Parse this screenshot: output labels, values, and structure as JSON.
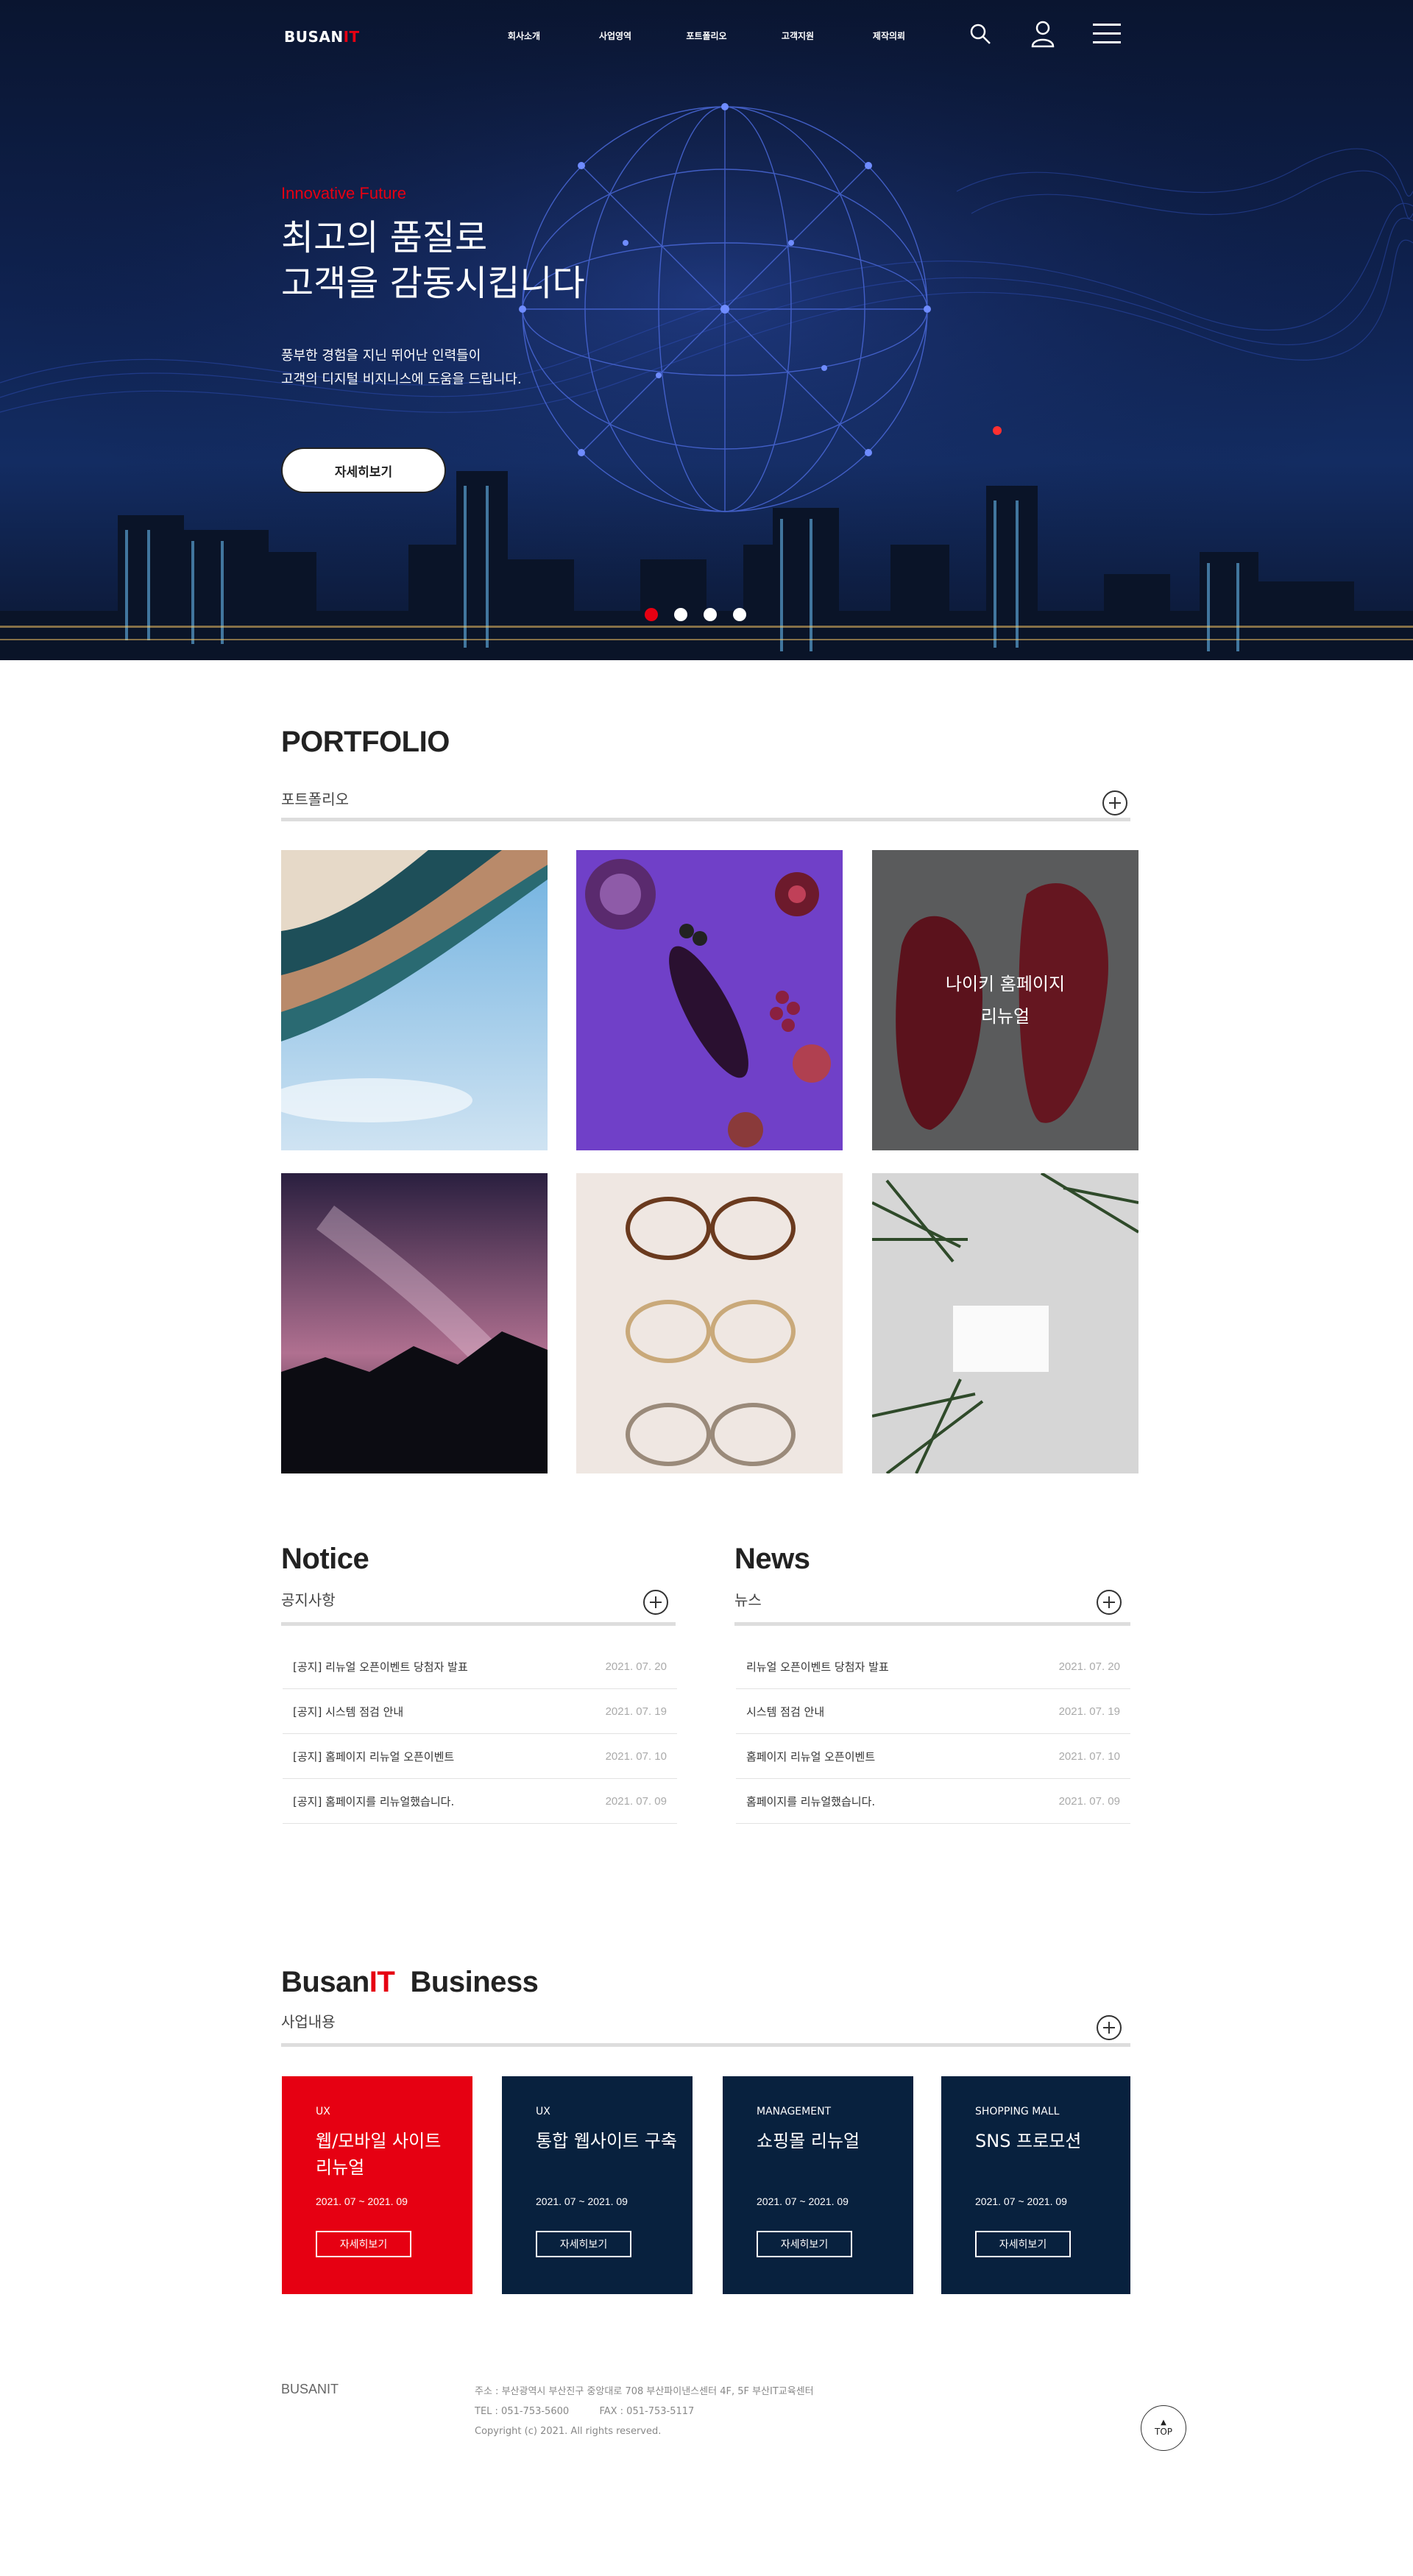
{
  "brand": {
    "logo_main": "BUSAN",
    "logo_accent": "IT",
    "accent": "#e60012",
    "navy": "#08213e"
  },
  "header": {
    "nav": [
      "회사소개",
      "사업영역",
      "포트폴리오",
      "고객지원",
      "제작의뢰"
    ],
    "icons": [
      "search-icon",
      "user-icon",
      "menu-icon"
    ]
  },
  "hero": {
    "subtitle": "Innovative Future",
    "title_line1": "최고의 품질로",
    "title_line2": "고객을 감동시킵니다",
    "desc_line1": "풍부한 경험을 지닌 뛰어난 인력들이",
    "desc_line2": "고객의 디지털 비지니스에 도움을 드립니다.",
    "button": "자세히보기",
    "slides_total": 4,
    "slide_active": 1
  },
  "portfolio": {
    "title": "PORTFOLIO",
    "subtitle": "포트폴리오",
    "overlay_line1": "나이키 홈페이지",
    "overlay_line2": "리뉴얼"
  },
  "notice": {
    "title": "Notice",
    "subtitle": "공지사항",
    "items": [
      {
        "title": "[공지] 리뉴얼 오픈이벤트 당첨자 발표",
        "date": "2021. 07. 20"
      },
      {
        "title": "[공지] 시스템 점검 안내",
        "date": "2021. 07. 19"
      },
      {
        "title": "[공지] 홈페이지 리뉴얼 오픈이벤트",
        "date": "2021. 07. 10"
      },
      {
        "title": "[공지] 홈페이지를 리뉴얼했습니다.",
        "date": "2021. 07. 09"
      }
    ]
  },
  "news": {
    "title": "News",
    "subtitle": "뉴스",
    "items": [
      {
        "title": "리뉴얼 오픈이벤트 당첨자 발표",
        "date": "2021. 07. 20"
      },
      {
        "title": "시스템 점검 안내",
        "date": "2021. 07. 19"
      },
      {
        "title": "홈페이지 리뉴얼 오픈이벤트",
        "date": "2021. 07. 10"
      },
      {
        "title": "홈페이지를 리뉴얼했습니다.",
        "date": "2021. 07. 09"
      }
    ]
  },
  "business": {
    "title_main": "Busan",
    "title_accent": "IT",
    "title_rest": "Business",
    "subtitle": "사업내용",
    "cards": [
      {
        "category": "UX",
        "name_line1": "웹/모바일 사이트",
        "name_line2": "리뉴얼",
        "date": "2021. 07 ~ 2021. 09",
        "button": "자세히보기"
      },
      {
        "category": "UX",
        "name_line1": "통합 웹사이트 구축",
        "name_line2": "",
        "date": "2021. 07 ~ 2021. 09",
        "button": "자세히보기"
      },
      {
        "category": "MANAGEMENT",
        "name_line1": "쇼핑몰 리뉴얼",
        "name_line2": "",
        "date": "2021. 07 ~ 2021. 09",
        "button": "자세히보기"
      },
      {
        "category": "SHOPPING MALL",
        "name_line1": "SNS 프로모션",
        "name_line2": "",
        "date": "2021. 07 ~ 2021. 09",
        "button": "자세히보기"
      }
    ]
  },
  "footer": {
    "logo": "BUSANIT",
    "address": "주소 : 부산광역시 부산진구 중앙대로 708 부산파이낸스센터 4F, 5F 부산IT교육센터",
    "contact": "TEL : 051-753-5600          FAX : 051-753-5117",
    "copyright": "Copyright (c) 2021. All rights reserved.",
    "top_button": "TOP"
  }
}
